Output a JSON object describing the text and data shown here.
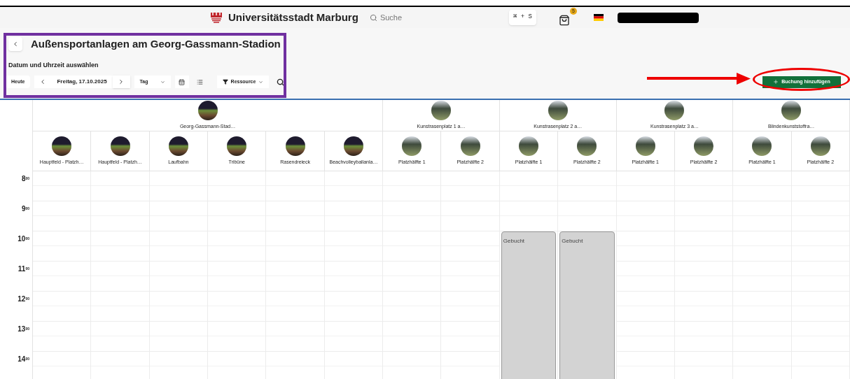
{
  "header": {
    "title": "Universitätsstadt Marburg",
    "search": {
      "placeholder": "Suche"
    },
    "shortcut": "⌘ + S",
    "cart_badge": "5"
  },
  "page": {
    "title": "Außensportanlagen am Georg-Gassmann-Stadion",
    "subtitle": "Datum und Uhrzeit auswählen"
  },
  "toolbar": {
    "today": "Heute",
    "date": "Freitag, 17.10.2025",
    "view": "Tag",
    "resource": "Ressource",
    "add_button": "Buchung hinzufügen"
  },
  "groups": [
    {
      "name": "Georg-Gassmann-Stad…",
      "children": [
        {
          "name": "Hauptfeld - Platzh…"
        },
        {
          "name": "Hauptfeld - Platzh…"
        },
        {
          "name": "Laufbahn"
        },
        {
          "name": "Tribüne"
        },
        {
          "name": "Rasendreieck"
        },
        {
          "name": "Beachvolleyballanla…"
        }
      ]
    },
    {
      "name": "Kunstrasenplatz 1 a…",
      "children": [
        {
          "name": "Platzhälfte 1"
        },
        {
          "name": "Platzhälfte 2"
        }
      ]
    },
    {
      "name": "Kunstrasenplatz 2 a…",
      "children": [
        {
          "name": "Platzhälfte 1",
          "schedule": [
            {
              "kind": "free"
            },
            {
              "kind": "free"
            },
            {
              "kind": "booked",
              "label": "Gebucht"
            }
          ]
        },
        {
          "name": "Platzhälfte 2",
          "schedule": [
            {
              "kind": "free"
            },
            {
              "kind": "free"
            },
            {
              "kind": "booked",
              "label": "Gebucht"
            }
          ]
        }
      ]
    },
    {
      "name": "Kunstrasenplatz 3 a…",
      "children": [
        {
          "name": "Platzhälfte 1"
        },
        {
          "name": "Platzhälfte 2"
        }
      ]
    },
    {
      "name": "Blindenkunststoffra…",
      "children": [
        {
          "name": "Platzhälfte 1"
        },
        {
          "name": "Platzhälfte 2"
        }
      ]
    }
  ],
  "hours": [
    {
      "hour": "8",
      "minutes": "00"
    },
    {
      "hour": "9",
      "minutes": "00"
    },
    {
      "hour": "10",
      "minutes": "00"
    },
    {
      "hour": "11",
      "minutes": "00"
    },
    {
      "hour": "12",
      "minutes": "00"
    },
    {
      "hour": "13",
      "minutes": "00"
    },
    {
      "hour": "14",
      "minutes": "00"
    }
  ]
}
